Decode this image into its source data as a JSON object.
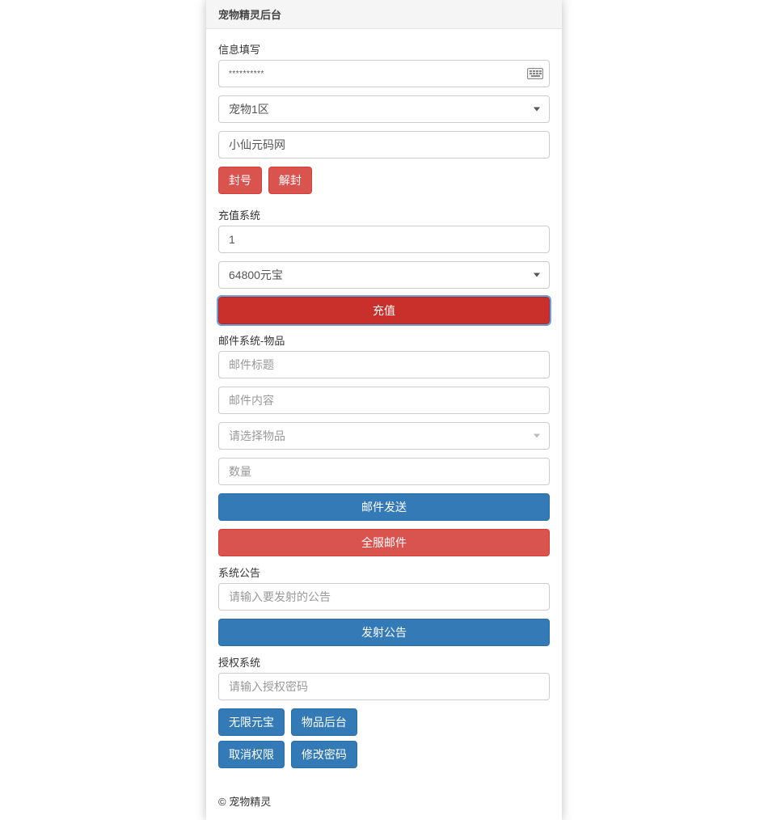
{
  "header": {
    "title": "宠物精灵后台"
  },
  "info": {
    "label": "信息填写",
    "password_value": "**********",
    "zone_selected": "宠物1区",
    "name_value": "小仙元码网",
    "ban_label": "封号",
    "unban_label": "解封"
  },
  "recharge": {
    "label": "充值系统",
    "amount_value": "1",
    "package_selected": "64800元宝",
    "submit_label": "充值"
  },
  "mail": {
    "label": "邮件系统-物品",
    "title_placeholder": "邮件标题",
    "content_placeholder": "邮件内容",
    "item_placeholder": "请选择物品",
    "qty_placeholder": "数量",
    "send_label": "邮件发送",
    "broadcast_label": "全服邮件"
  },
  "announce": {
    "label": "系统公告",
    "placeholder": "请输入要发射的公告",
    "submit_label": "发射公告"
  },
  "auth": {
    "label": "授权系统",
    "placeholder": "请输入授权密码",
    "btn_unlimited": "无限元宝",
    "btn_items": "物品后台",
    "btn_revoke": "取消权限",
    "btn_changepw": "修改密码"
  },
  "footer": {
    "text": "© 宠物精灵"
  }
}
